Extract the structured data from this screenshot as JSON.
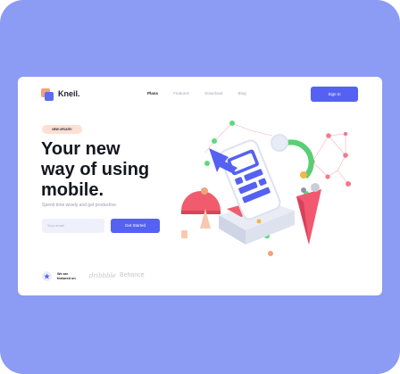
{
  "brand": "Kneil.",
  "nav": {
    "items": [
      {
        "label": "Plans",
        "active": true
      },
      {
        "label": "Features",
        "active": false
      },
      {
        "label": "Download",
        "active": false
      },
      {
        "label": "Blog",
        "active": false
      }
    ],
    "signin": "Sign In"
  },
  "hero": {
    "badge": "NEW UPDATE!",
    "title_line1": "Your new",
    "title_line2": "way of using",
    "title_line3": "mobile.",
    "subtitle": "Spend time wisely and get productive.",
    "email_placeholder": "Your email",
    "cta": "Get Started"
  },
  "featured": {
    "text": "We are featured on",
    "logos": [
      "dribbble",
      "Behance"
    ]
  },
  "colors": {
    "background": "#8c9bf3",
    "primary": "#5561f2",
    "badge": "#fde0d3",
    "accent_orange": "#f2a27a"
  }
}
